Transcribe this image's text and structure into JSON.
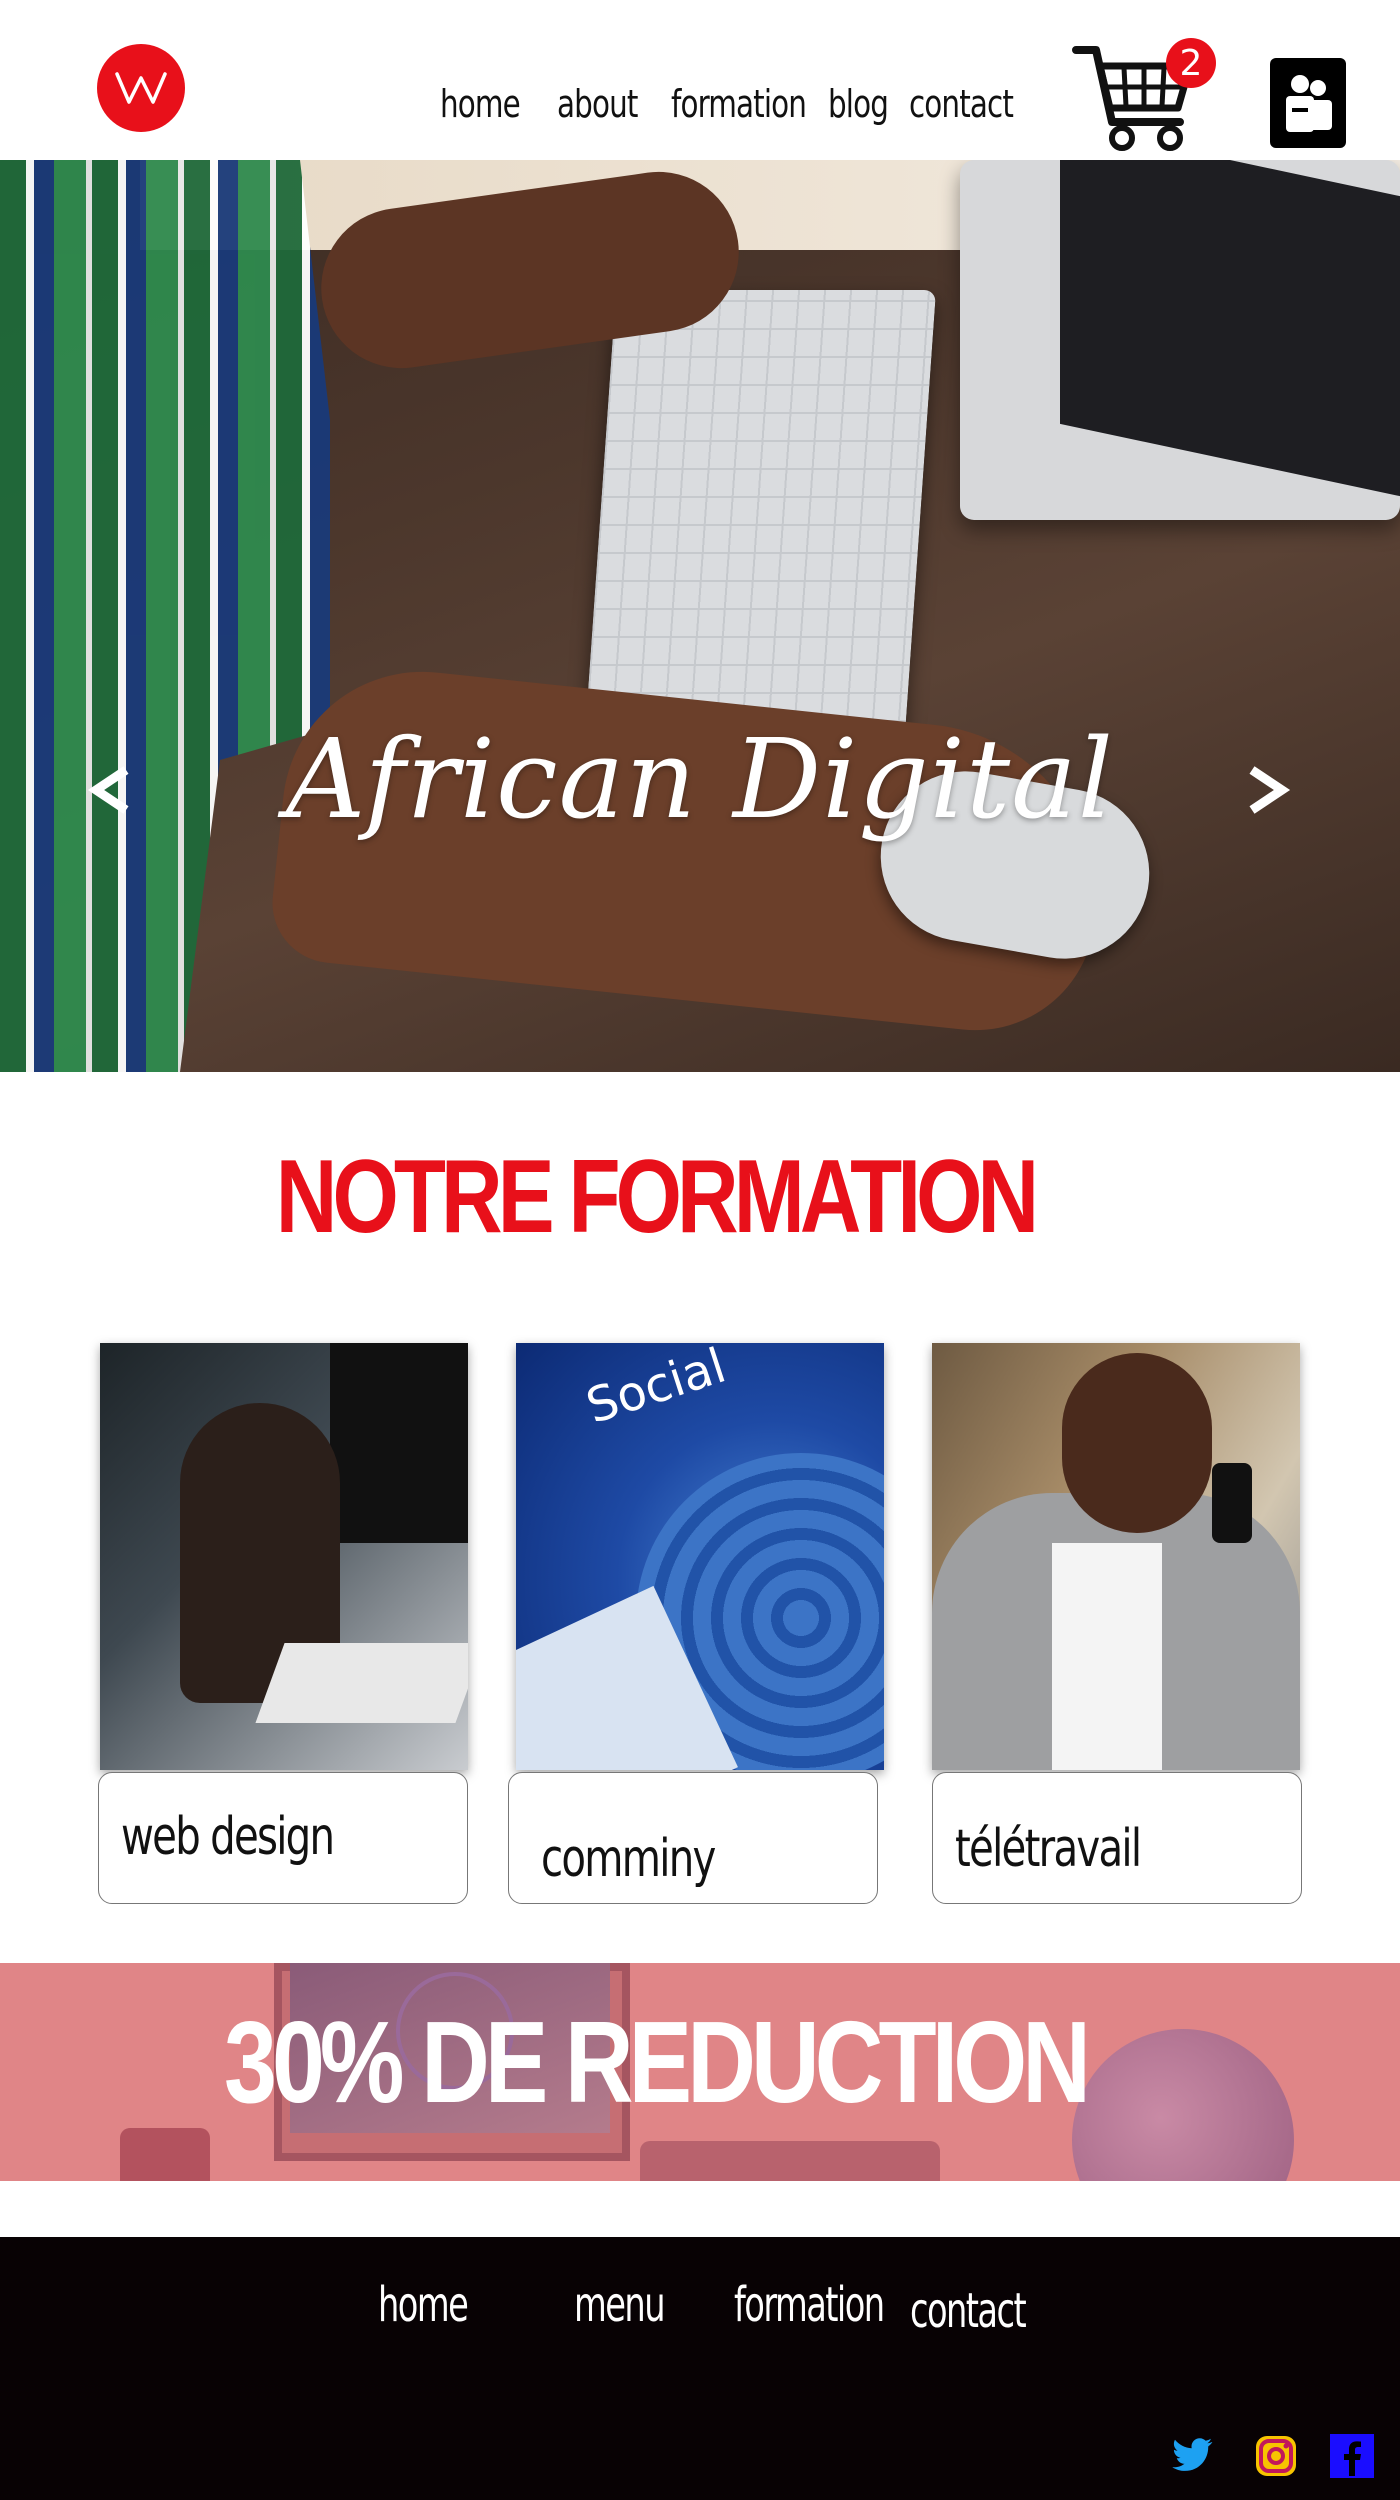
{
  "header": {
    "logo_icon": "w-logo-icon",
    "nav": [
      {
        "label": "home"
      },
      {
        "label": "about"
      },
      {
        "label": "formation"
      },
      {
        "label": "blog"
      },
      {
        "label": "contact"
      }
    ],
    "cart_icon": "shopping-cart-icon",
    "cart_count": "2",
    "user_icon": "user-group-icon"
  },
  "hero": {
    "title": "African Digital",
    "prev_icon": "chevron-left-icon",
    "next_icon": "chevron-right-icon"
  },
  "section": {
    "title": "NOTRE FORMATION"
  },
  "cards": [
    {
      "label": "web design"
    },
    {
      "label": "comminy"
    },
    {
      "label": "télétravail"
    }
  ],
  "promo": {
    "text": "30% DE REDUCTION"
  },
  "footer": {
    "nav": [
      {
        "label": "home"
      },
      {
        "label": "menu"
      },
      {
        "label": "formation"
      },
      {
        "label": "contact"
      }
    ],
    "social": [
      "twitter-icon",
      "instagram-icon",
      "facebook-icon"
    ]
  },
  "colors": {
    "brand_red": "#e8101a",
    "promo_pink": "#e08587",
    "footer_bg": "#080204",
    "twitter_blue": "#1da1f2",
    "facebook_blue": "#1a0dff",
    "instagram_yellow": "#f7c400"
  }
}
